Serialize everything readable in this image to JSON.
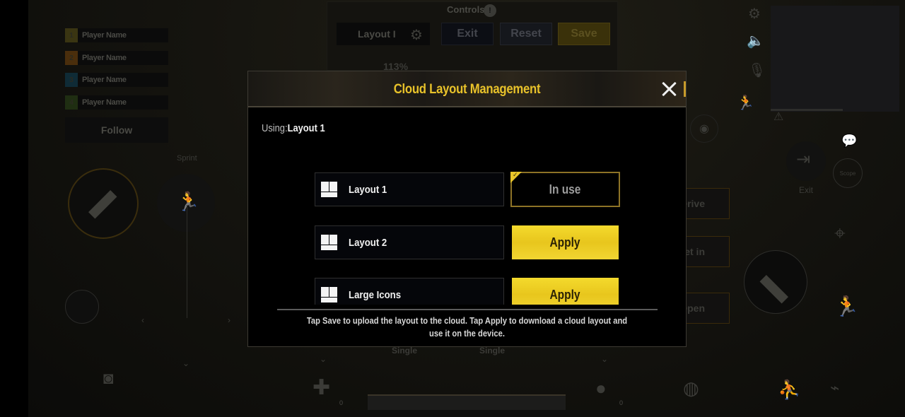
{
  "background": {
    "players": [
      {
        "index": "1",
        "name": "Player Name",
        "color": "#3a3512"
      },
      {
        "index": "2",
        "name": "Player Name",
        "color": "#4a2e0c"
      },
      {
        "index": "3",
        "name": "Player Name",
        "color": "#0f2b36"
      },
      {
        "index": "4",
        "name": "Player Name",
        "color": "#1f2e12"
      }
    ],
    "follow_label": "Follow",
    "controls": {
      "title": "Controls",
      "info_icon": "info-icon",
      "layout_name": "Layout I",
      "exit_label": "Exit",
      "reset_label": "Reset",
      "save_label": "Save",
      "scale_value": "113%"
    },
    "sprint_label": "Sprint",
    "exit_label": "Exit",
    "scope_label": "Scope",
    "action_buttons": [
      "Drive",
      "Get in",
      "Open"
    ],
    "fire_modes": [
      "Single",
      "Single"
    ],
    "medkit_count": "0",
    "grenade_count": "0"
  },
  "modal": {
    "title": "Cloud Layout Management",
    "using_label": "Using:",
    "using_value": "Layout 1",
    "layouts": [
      {
        "name": "Layout 1",
        "action": "In use",
        "state": "in-use"
      },
      {
        "name": "Layout 2",
        "action": "Apply",
        "state": "apply"
      },
      {
        "name": "Large Icons",
        "action": "Apply",
        "state": "apply"
      }
    ],
    "hint": "Tap Save to upload the layout to the cloud. Tap Apply to download a cloud layout and use it on the device.",
    "colors": {
      "title": "#e8c22a",
      "apply_bg": "#f0d22a",
      "in_use_border": "#8d7326"
    }
  }
}
